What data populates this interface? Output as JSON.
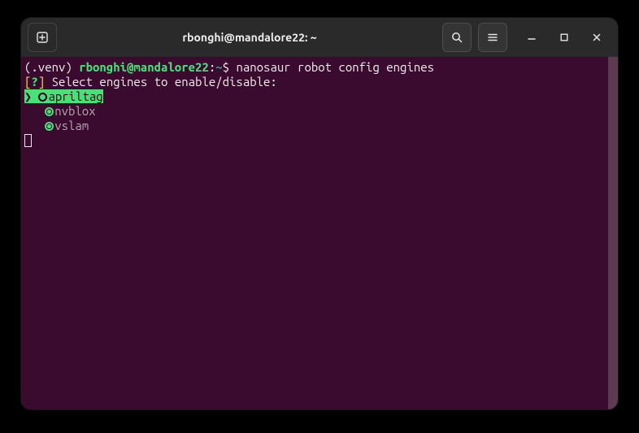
{
  "window": {
    "title": "rbonghi@mandalore22: ~"
  },
  "prompt": {
    "venv": "(.venv) ",
    "userhost": "rbonghi@mandalore22",
    "colon": ":",
    "path": "~",
    "dollar": "$ ",
    "command": "nanosaur robot config engines"
  },
  "question": {
    "openbracket": "[",
    "qmark": "?",
    "closebracket": "] ",
    "text": "Select engines to enable/disable:"
  },
  "options": {
    "pointer": "❯ ",
    "indent": "   ",
    "0": {
      "label": "apriltag"
    },
    "1": {
      "label": "nvblox"
    },
    "2": {
      "label": "vslam"
    }
  }
}
